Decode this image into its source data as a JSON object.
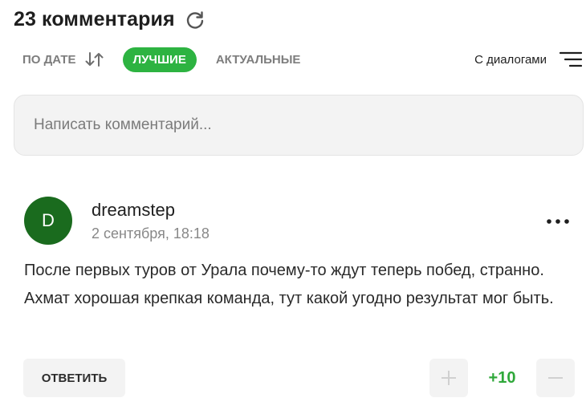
{
  "header": {
    "title": "23 комментария",
    "refresh_icon": "refresh-icon"
  },
  "sort": {
    "by_date": "ПО ДАТЕ",
    "best": "ЛУЧШИЕ",
    "actual": "АКТУАЛЬНЫЕ",
    "active": "best",
    "sort_icon": "sort-arrows-icon",
    "dialogs_label": "С диалогами",
    "menu_icon": "menu-lines-icon"
  },
  "input": {
    "placeholder": "Написать комментарий..."
  },
  "comment": {
    "avatar_letter": "D",
    "author": "dreamstep",
    "timestamp": "2 сентября, 18:18",
    "text": "После первых туров от Урала почему-то ждут теперь побед, странно. Ахмат хорошая крепкая команда, тут какой угодно результат мог быть.",
    "reply_label": "ОТВЕТИТЬ",
    "score": "+10",
    "more_icon": "more-dots-icon"
  },
  "colors": {
    "accent_green": "#2db341",
    "avatar_green": "#1a6b1e",
    "score_green": "#2fa83a"
  }
}
